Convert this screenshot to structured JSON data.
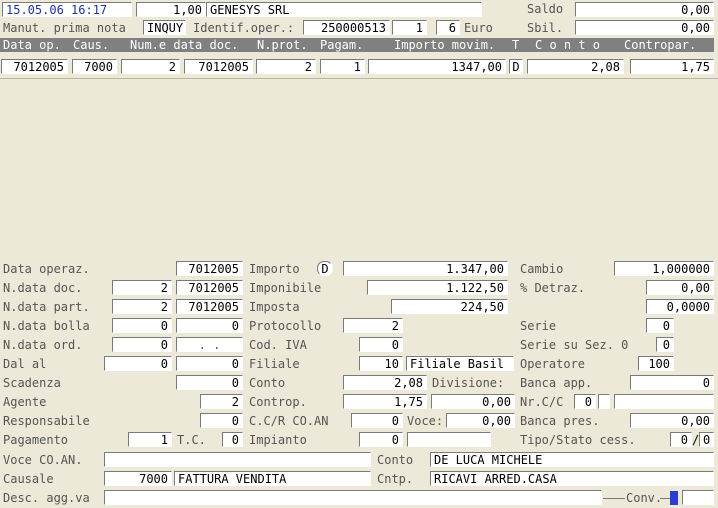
{
  "header": {
    "datetime": "15.05.06 16:17",
    "rate": "1,00",
    "company": "GENESYS SRL",
    "saldo_label": "Saldo",
    "saldo_value": "0,00",
    "manut_label": "Manut. prima nota",
    "manut_value": "INQUY",
    "identif_label": "Identif.oper.:",
    "identif_value": "250000513",
    "identif_n1": "1",
    "identif_n2": "6",
    "currency": "Euro",
    "sbil_label": "Sbil.",
    "sbil_value": "0,00"
  },
  "grid": {
    "columns": [
      "Data op.",
      "Caus.",
      "Num.e data doc.",
      "N.prot.",
      "Pagam.",
      "Importo movim.",
      "T",
      "C o n t o",
      "Contropar."
    ],
    "rows": [
      {
        "data_op": "7012005",
        "caus": "7000",
        "num": "2",
        "data_doc": "7012005",
        "nprot": "2",
        "pagam": "1",
        "importo": "1347,00",
        "t": "D",
        "conto": "2,08",
        "contropar": "1,75"
      }
    ]
  },
  "detail": {
    "data_operaz_label": "Data operaz.",
    "data_operaz": "7012005",
    "importo_label": "Importo",
    "importo_dc": "D",
    "importo": "1.347,00",
    "cambio_label": "Cambio",
    "cambio": "1,000000",
    "ndata_doc_label": "N.data doc.",
    "ndoc": "2",
    "data_doc": "7012005",
    "imponibile_label": "Imponibile",
    "imponibile": "1.122,50",
    "detraz_label": "% Detraz.",
    "detraz": "0,00",
    "ndata_part_label": "N.data part.",
    "npart": "2",
    "data_part": "7012005",
    "imposta_label": "Imposta",
    "imposta": "224,50",
    "imposta_pct": "0,0000",
    "ndata_bolla_label": "N.data bolla",
    "nbolla": "0",
    "data_bolla": "0",
    "protocollo_label": "Protocollo",
    "protocollo": "2",
    "serie_label": "Serie",
    "serie": "0",
    "ndata_ord_label": "N.data ord.",
    "nord": "0",
    "data_ord": ". .",
    "cod_iva_label": "Cod. IVA",
    "cod_iva": "0",
    "serie_sez_label": "Serie su Sez. 0",
    "serie_sez": "0",
    "dal_al_label": "Dal al",
    "dal": "0",
    "al": "0",
    "filiale_label": "Filiale",
    "filiale": "10",
    "filiale_name": "Filiale Basil",
    "operatore_label": "Operatore",
    "operatore": "100",
    "scadenza_label": "Scadenza",
    "scadenza": "0",
    "conto_label": "Conto",
    "conto": "2,08",
    "divisione_label": "Divisione:",
    "banca_app_label": "Banca app.",
    "banca_app": "0",
    "agente_label": "Agente",
    "agente": "2",
    "controp_label": "Controp.",
    "controp": "1,75",
    "controp_val": "0,00",
    "nrcc_label": "Nr.C/C",
    "nrcc": "0",
    "responsabile_label": "Responsabile",
    "responsabile": "0",
    "ccr_label": "C.C/R CO.AN",
    "ccr": "0",
    "voce_label": "Voce:",
    "voce": "0,00",
    "banca_pres_label": "Banca pres.",
    "banca_pres": "0,00",
    "pagamento_label": "Pagamento",
    "pagamento": "1",
    "tc_label": "T.C.",
    "tc": "0",
    "impianto_label": "Impianto",
    "impianto": "0",
    "tipo_stato_label": "Tipo/Stato cess.",
    "tipo": "0",
    "stato": "0",
    "voce_coan_label": "Voce CO.AN.",
    "conto_name_label": "Conto",
    "conto_name": "DE LUCA MICHELE",
    "causale_label": "Causale",
    "causale_code": "7000",
    "causale_desc": "FATTURA VENDITA",
    "cntp_label": "Cntp.",
    "cntp": "RICAVI ARRED.CASA",
    "desc_label": "Desc. agg.va",
    "conv_label": "Conv."
  }
}
